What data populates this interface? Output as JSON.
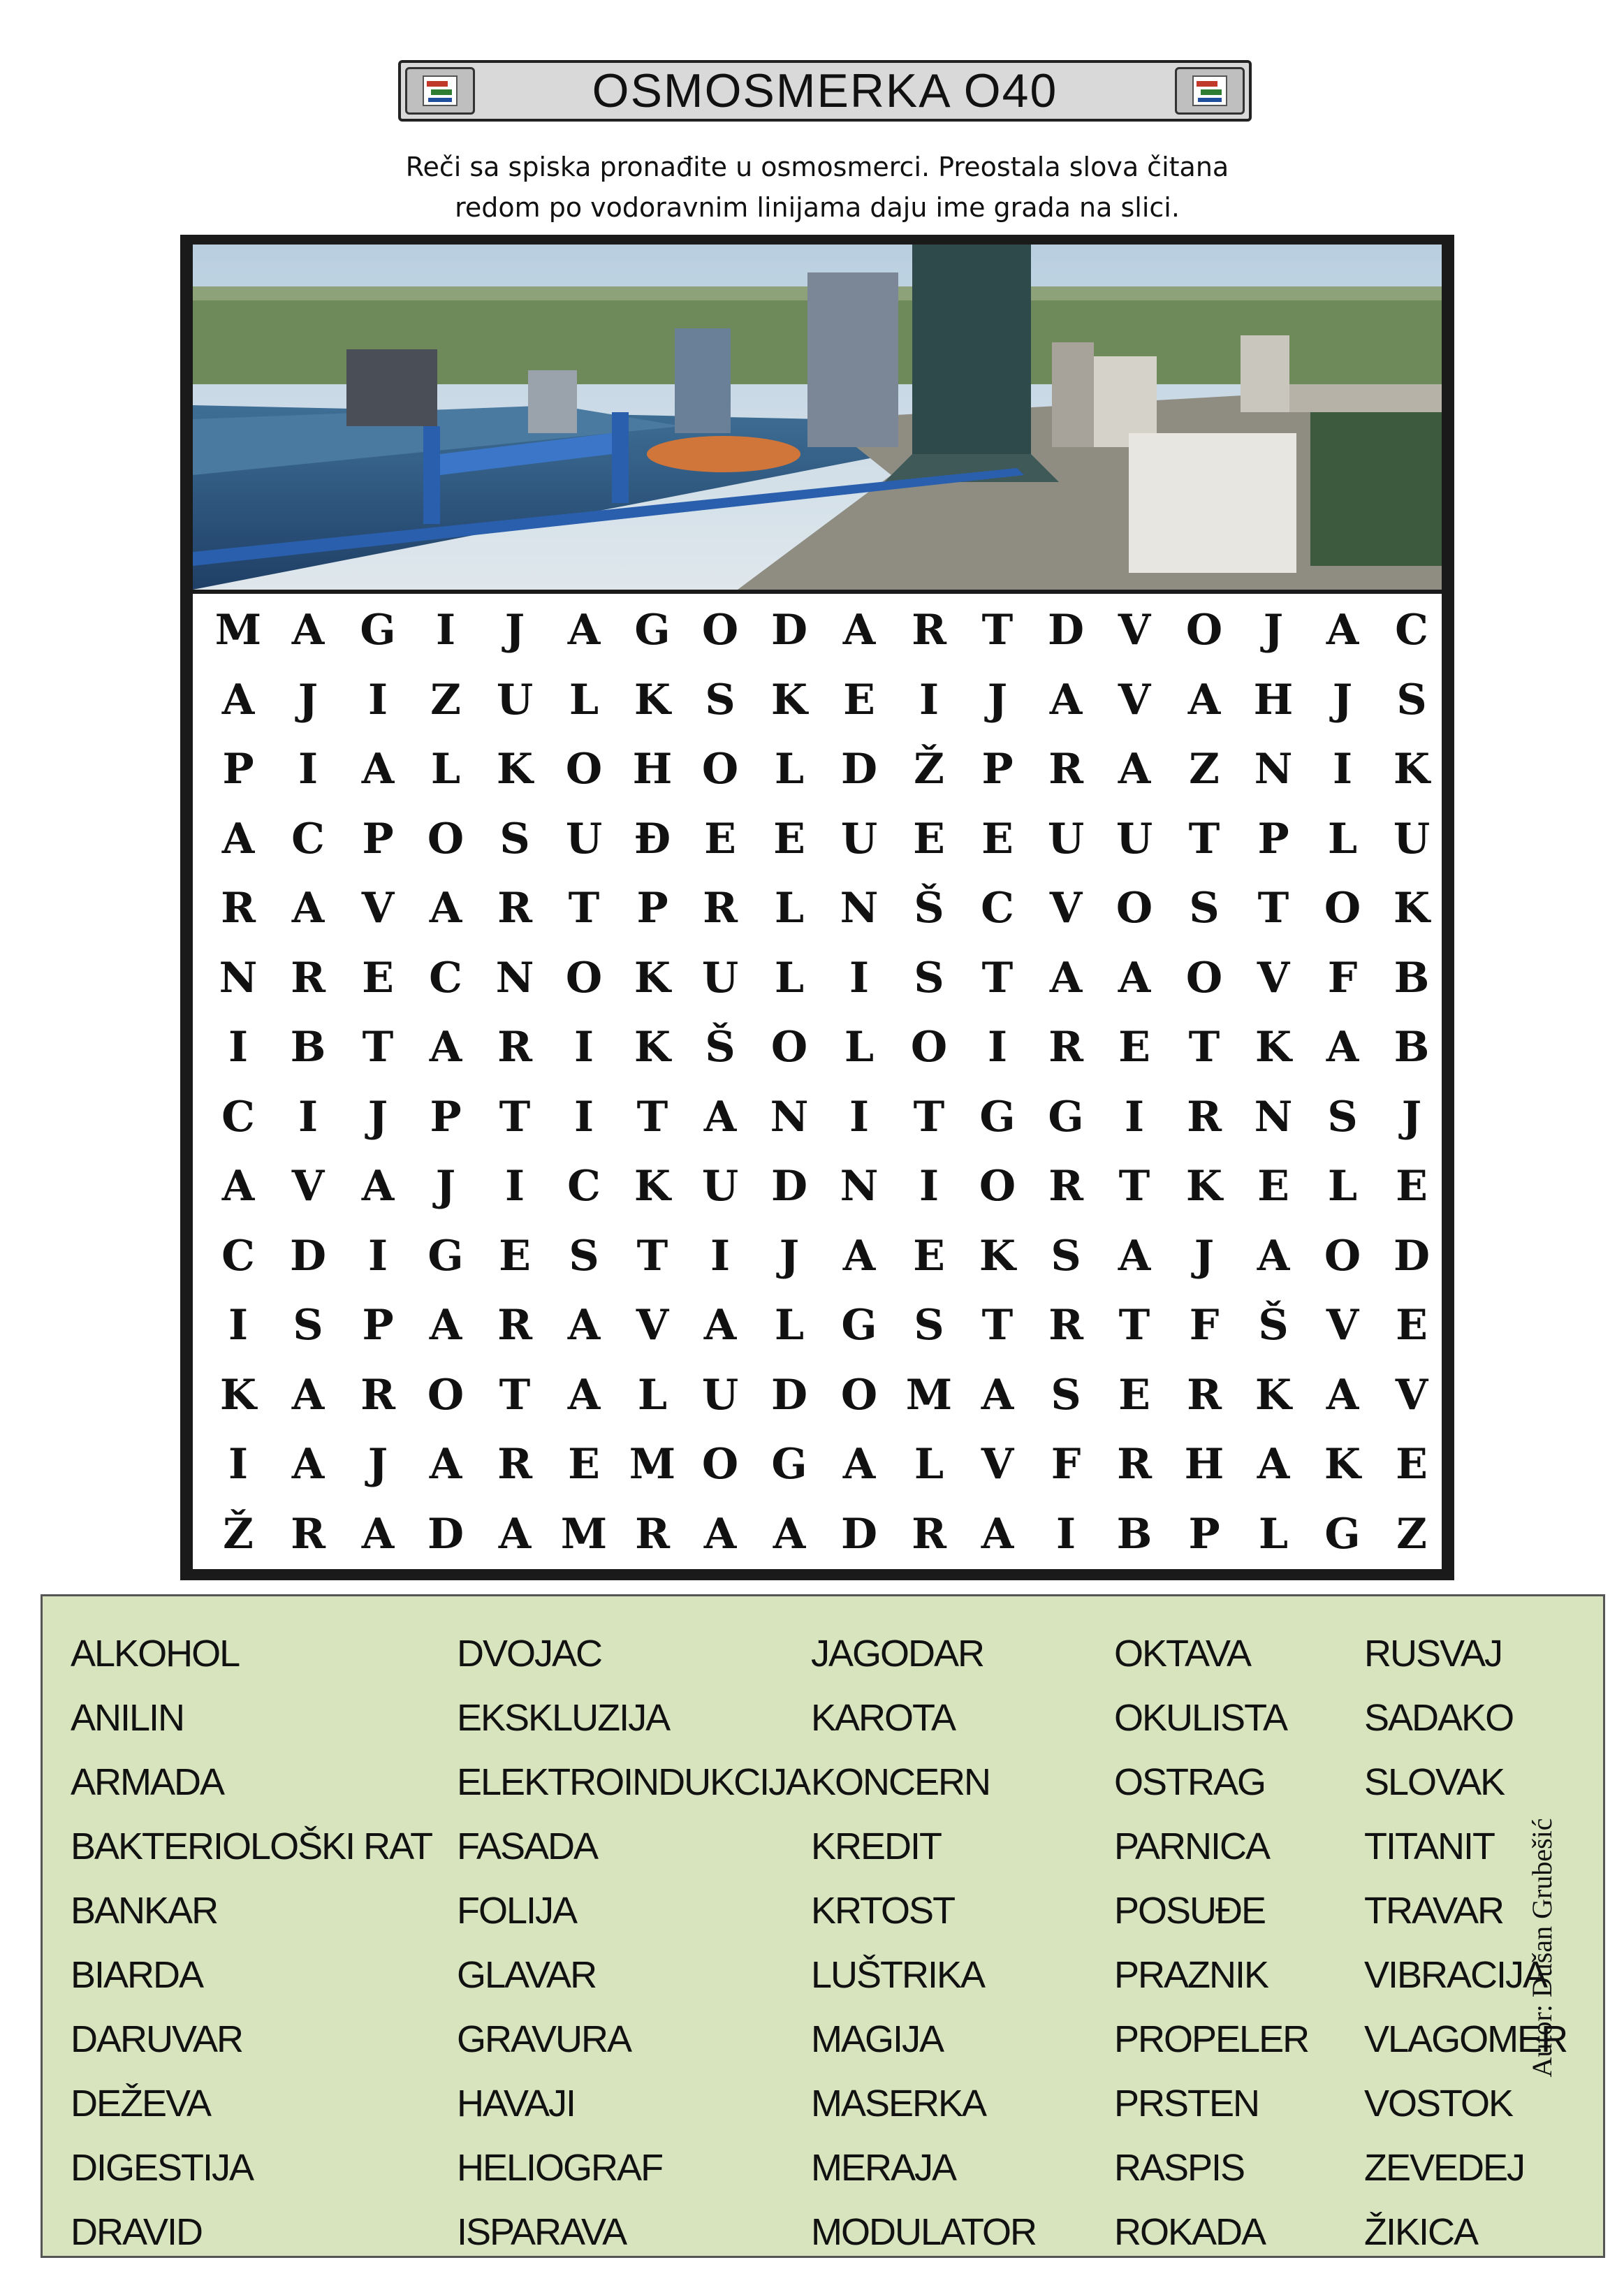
{
  "title": "OSMOSMERKA O40",
  "instructions": {
    "line1": "Reči sa spiska pronađite u osmosmerci. Preostala slova čitana",
    "line2": "redom po vodoravnim linijama daju ime grada na slici."
  },
  "grid": [
    [
      "M",
      "A",
      "G",
      "I",
      "J",
      "A",
      "G",
      "O",
      "D",
      "A",
      "R",
      "T",
      "D",
      "V",
      "O",
      "J",
      "A",
      "C"
    ],
    [
      "A",
      "J",
      "I",
      "Z",
      "U",
      "L",
      "K",
      "S",
      "K",
      "E",
      "I",
      "J",
      "A",
      "V",
      "A",
      "H",
      "J",
      "S"
    ],
    [
      "P",
      "I",
      "A",
      "L",
      "K",
      "O",
      "H",
      "O",
      "L",
      "D",
      "Ž",
      "P",
      "R",
      "A",
      "Z",
      "N",
      "I",
      "K"
    ],
    [
      "A",
      "C",
      "P",
      "O",
      "S",
      "U",
      "Đ",
      "E",
      "E",
      "U",
      "E",
      "E",
      "U",
      "U",
      "T",
      "P",
      "L",
      "U"
    ],
    [
      "R",
      "A",
      "V",
      "A",
      "R",
      "T",
      "P",
      "R",
      "L",
      "N",
      "Š",
      "C",
      "V",
      "O",
      "S",
      "T",
      "O",
      "K"
    ],
    [
      "N",
      "R",
      "E",
      "C",
      "N",
      "O",
      "K",
      "U",
      "L",
      "I",
      "S",
      "T",
      "A",
      "A",
      "O",
      "V",
      "F",
      "B"
    ],
    [
      "I",
      "B",
      "T",
      "A",
      "R",
      "I",
      "K",
      "Š",
      "O",
      "L",
      "O",
      "I",
      "R",
      "E",
      "T",
      "K",
      "A",
      "B"
    ],
    [
      "C",
      "I",
      "J",
      "P",
      "T",
      "I",
      "T",
      "A",
      "N",
      "I",
      "T",
      "G",
      "G",
      "I",
      "R",
      "N",
      "S",
      "J"
    ],
    [
      "A",
      "V",
      "A",
      "J",
      "I",
      "C",
      "K",
      "U",
      "D",
      "N",
      "I",
      "O",
      "R",
      "T",
      "K",
      "E",
      "L",
      "E"
    ],
    [
      "C",
      "D",
      "I",
      "G",
      "E",
      "S",
      "T",
      "I",
      "J",
      "A",
      "E",
      "K",
      "S",
      "A",
      "J",
      "A",
      "O",
      "D"
    ],
    [
      "I",
      "S",
      "P",
      "A",
      "R",
      "A",
      "V",
      "A",
      "L",
      "G",
      "S",
      "T",
      "R",
      "T",
      "F",
      "Š",
      "V",
      "E"
    ],
    [
      "K",
      "A",
      "R",
      "O",
      "T",
      "A",
      "L",
      "U",
      "D",
      "O",
      "M",
      "A",
      "S",
      "E",
      "R",
      "K",
      "A",
      "V"
    ],
    [
      "I",
      "A",
      "J",
      "A",
      "R",
      "E",
      "M",
      "O",
      "G",
      "A",
      "L",
      "V",
      "F",
      "R",
      "H",
      "A",
      "K",
      "E"
    ],
    [
      "Ž",
      "R",
      "A",
      "D",
      "A",
      "M",
      "R",
      "A",
      "A",
      "D",
      "R",
      "A",
      "I",
      "B",
      "P",
      "L",
      "G",
      "Z"
    ]
  ],
  "word_columns": [
    [
      "ALKOHOL",
      "ANILIN",
      "ARMADA",
      "BAKTERIOLOŠKI RAT",
      "BANKAR",
      "BIARDA",
      "DARUVAR",
      "DEŽEVA",
      "DIGESTIJA",
      "DRAVID"
    ],
    [
      "DVOJAC",
      "EKSKLUZIJA",
      "ELEKTROINDUKCIJA",
      "FASADA",
      "FOLIJA",
      "GLAVAR",
      "GRAVURA",
      "HAVAJI",
      "HELIOGRAF",
      "ISPARAVA"
    ],
    [
      "JAGODAR",
      "KAROTA",
      "KONCERN",
      "KREDIT",
      "KRTOST",
      "LUŠTRIKA",
      "MAGIJA",
      "MASERKA",
      "MERAJA",
      "MODULATOR"
    ],
    [
      "OKTAVA",
      "OKULISTA",
      "OSTRAG",
      "PARNICA",
      "POSUĐE",
      "PRAZNIK",
      "PROPELER",
      "PRSTEN",
      "RASPIS",
      "ROKADA"
    ],
    [
      "RUSVAJ",
      "SADAKO",
      "SLOVAK",
      "TITANIT",
      "TRAVAR",
      "VIBRACIJA",
      "VLAGOMER",
      "VOSTOK",
      "ZEVEDEJ",
      "ŽIKICA"
    ]
  ],
  "author": "Autor: Dušan Grubešić"
}
